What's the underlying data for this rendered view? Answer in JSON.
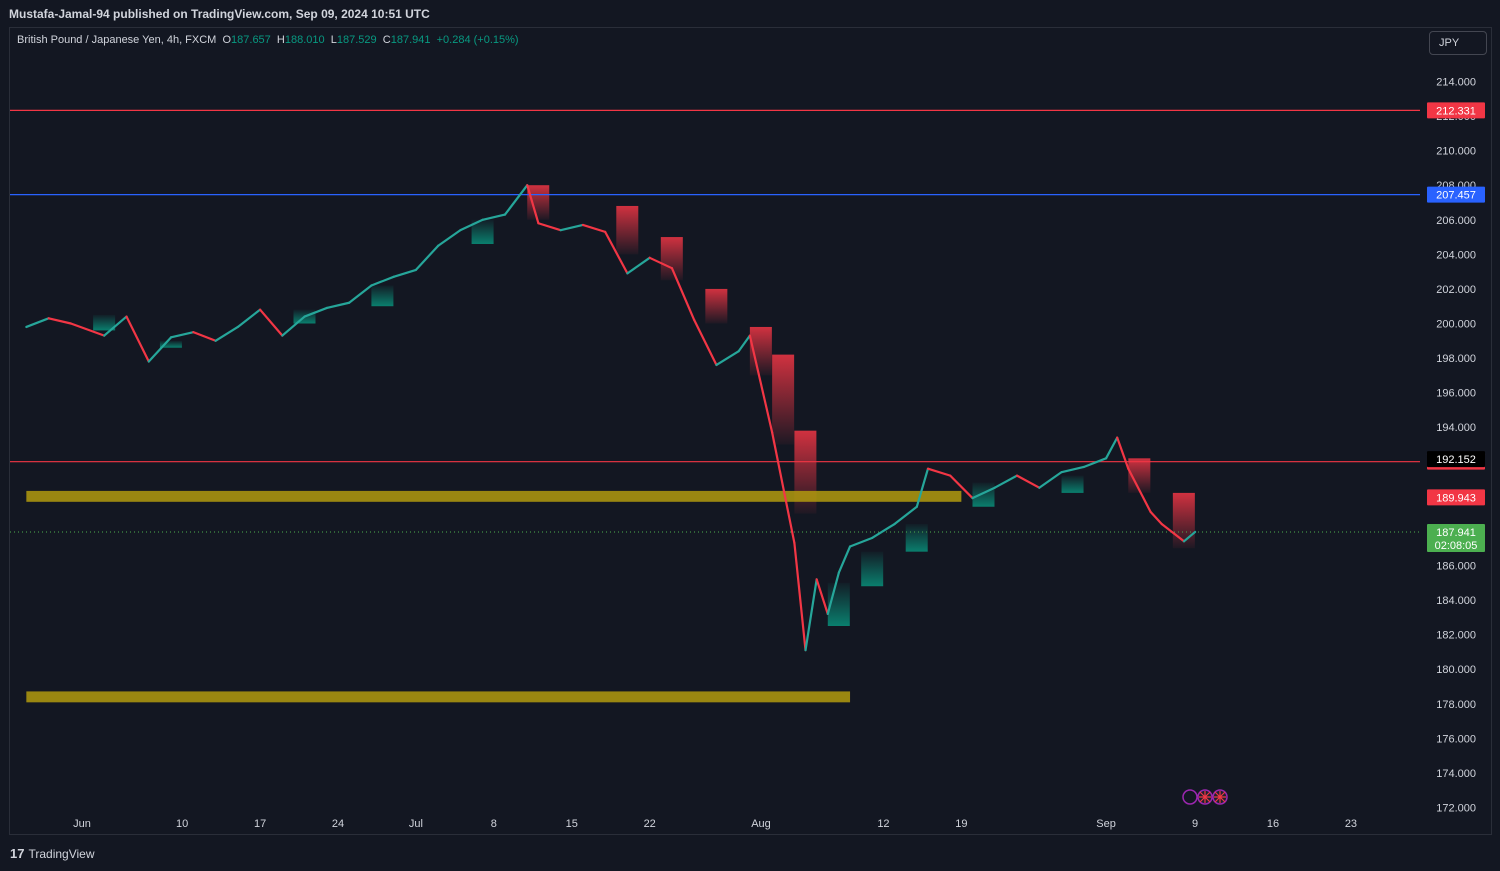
{
  "header": {
    "publisher": "Mustafa-Jamal-94 published on TradingView.com, Sep 09, 2024 10:51 UTC"
  },
  "legend": {
    "symbol": "British Pound / Japanese Yen, 4h, FXCM",
    "open_label": "O",
    "open": "187.657",
    "high_label": "H",
    "high": "188.010",
    "low_label": "L",
    "low": "187.529",
    "close_label": "C",
    "close": "187.941",
    "change": "+0.284 (+0.15%)"
  },
  "currency_button": "JPY",
  "footer": {
    "brand": "TradingView"
  },
  "colors": {
    "background": "#131722",
    "up": "#26a69a",
    "down": "#f23645",
    "red_line": "#f23645",
    "blue_line": "#2962ff",
    "zone": "#b39b0e",
    "last_price": "#4caf50"
  },
  "chart_data": {
    "type": "line",
    "title": "British Pound / Japanese Yen, 4h, FXCM",
    "xlabel": "",
    "ylabel": "",
    "ylim": [
      171.8,
      216.5
    ],
    "y_ticks": [
      172,
      174,
      176,
      178,
      180,
      182,
      184,
      186,
      188,
      190,
      192,
      194,
      196,
      198,
      200,
      202,
      204,
      206,
      208,
      210,
      212,
      214
    ],
    "y_tick_labels": [
      "172.000",
      "174.000",
      "176.000",
      "178.000",
      "180.000",
      "182.000",
      "184.000",
      "186.000",
      "188.000",
      "190.000",
      "192.000",
      "194.000",
      "196.000",
      "198.000",
      "200.000",
      "202.000",
      "204.000",
      "206.000",
      "208.000",
      "210.000",
      "212.000",
      "214.000"
    ],
    "x_ticks": [
      {
        "label": "Jun",
        "date": "2024-06-01"
      },
      {
        "label": "10",
        "date": "2024-06-10"
      },
      {
        "label": "17",
        "date": "2024-06-17"
      },
      {
        "label": "24",
        "date": "2024-06-24"
      },
      {
        "label": "Jul",
        "date": "2024-07-01"
      },
      {
        "label": "8",
        "date": "2024-07-08"
      },
      {
        "label": "15",
        "date": "2024-07-15"
      },
      {
        "label": "22",
        "date": "2024-07-22"
      },
      {
        "label": "Aug",
        "date": "2024-08-01"
      },
      {
        "label": "12",
        "date": "2024-08-12"
      },
      {
        "label": "19",
        "date": "2024-08-19"
      },
      {
        "label": "Sep",
        "date": "2024-09-01"
      },
      {
        "label": "9",
        "date": "2024-09-09"
      },
      {
        "label": "16",
        "date": "2024-09-16"
      },
      {
        "label": "23",
        "date": "2024-09-23"
      }
    ],
    "price_path": [
      [
        "2024-05-27",
        199.8
      ],
      [
        "2024-05-29",
        200.3
      ],
      [
        "2024-05-31",
        200.0
      ],
      [
        "2024-06-03",
        199.3
      ],
      [
        "2024-06-05",
        200.4
      ],
      [
        "2024-06-07",
        197.8
      ],
      [
        "2024-06-09",
        199.2
      ],
      [
        "2024-06-11",
        199.5
      ],
      [
        "2024-06-13",
        199.0
      ],
      [
        "2024-06-15",
        199.8
      ],
      [
        "2024-06-17",
        200.8
      ],
      [
        "2024-06-19",
        199.3
      ],
      [
        "2024-06-21",
        200.4
      ],
      [
        "2024-06-23",
        200.9
      ],
      [
        "2024-06-25",
        201.2
      ],
      [
        "2024-06-27",
        202.2
      ],
      [
        "2024-06-29",
        202.7
      ],
      [
        "2024-07-01",
        203.1
      ],
      [
        "2024-07-03",
        204.5
      ],
      [
        "2024-07-05",
        205.4
      ],
      [
        "2024-07-07",
        206.0
      ],
      [
        "2024-07-09",
        206.3
      ],
      [
        "2024-07-11",
        208.0
      ],
      [
        "2024-07-12",
        205.8
      ],
      [
        "2024-07-14",
        205.4
      ],
      [
        "2024-07-16",
        205.7
      ],
      [
        "2024-07-18",
        205.3
      ],
      [
        "2024-07-20",
        202.9
      ],
      [
        "2024-07-22",
        203.8
      ],
      [
        "2024-07-24",
        203.2
      ],
      [
        "2024-07-26",
        200.2
      ],
      [
        "2024-07-28",
        197.6
      ],
      [
        "2024-07-30",
        198.4
      ],
      [
        "2024-07-31",
        199.3
      ],
      [
        "2024-08-02",
        193.7
      ],
      [
        "2024-08-04",
        187.3
      ],
      [
        "2024-08-05",
        181.1
      ],
      [
        "2024-08-06",
        185.2
      ],
      [
        "2024-08-07",
        183.2
      ],
      [
        "2024-08-08",
        185.6
      ],
      [
        "2024-08-09",
        187.1
      ],
      [
        "2024-08-11",
        187.6
      ],
      [
        "2024-08-13",
        188.4
      ],
      [
        "2024-08-15",
        189.4
      ],
      [
        "2024-08-16",
        191.6
      ],
      [
        "2024-08-18",
        191.2
      ],
      [
        "2024-08-20",
        189.9
      ],
      [
        "2024-08-22",
        190.5
      ],
      [
        "2024-08-24",
        191.2
      ],
      [
        "2024-08-26",
        190.5
      ],
      [
        "2024-08-28",
        191.4
      ],
      [
        "2024-08-30",
        191.7
      ],
      [
        "2024-09-01",
        192.2
      ],
      [
        "2024-09-02",
        193.4
      ],
      [
        "2024-09-03",
        191.6
      ],
      [
        "2024-09-05",
        189.1
      ],
      [
        "2024-09-06",
        188.4
      ],
      [
        "2024-09-08",
        187.4
      ],
      [
        "2024-09-09",
        187.94
      ]
    ],
    "supply_zones": [
      {
        "date": "2024-07-11",
        "top": 208.0,
        "bottom": 206.0
      },
      {
        "date": "2024-07-19",
        "top": 206.8,
        "bottom": 204.0
      },
      {
        "date": "2024-07-23",
        "top": 205.0,
        "bottom": 202.5
      },
      {
        "date": "2024-07-27",
        "top": 202.0,
        "bottom": 200.0
      },
      {
        "date": "2024-07-31",
        "top": 199.8,
        "bottom": 197.0
      },
      {
        "date": "2024-08-02",
        "top": 198.2,
        "bottom": 193.0
      },
      {
        "date": "2024-08-04",
        "top": 193.8,
        "bottom": 189.0
      },
      {
        "date": "2024-09-03",
        "top": 192.2,
        "bottom": 190.2
      },
      {
        "date": "2024-09-07",
        "top": 190.2,
        "bottom": 187.0
      }
    ],
    "demand_zones": [
      {
        "date": "2024-06-02",
        "top": 200.5,
        "bottom": 199.6
      },
      {
        "date": "2024-06-08",
        "top": 199.0,
        "bottom": 198.6
      },
      {
        "date": "2024-06-20",
        "top": 200.8,
        "bottom": 200.0
      },
      {
        "date": "2024-06-27",
        "top": 202.2,
        "bottom": 201.0
      },
      {
        "date": "2024-07-06",
        "top": 206.0,
        "bottom": 204.6
      },
      {
        "date": "2024-08-07",
        "top": 185.0,
        "bottom": 182.5
      },
      {
        "date": "2024-08-10",
        "top": 186.8,
        "bottom": 184.8
      },
      {
        "date": "2024-08-14",
        "top": 188.4,
        "bottom": 186.8
      },
      {
        "date": "2024-08-20",
        "top": 190.8,
        "bottom": 189.4
      },
      {
        "date": "2024-08-28",
        "top": 191.2,
        "bottom": 190.2
      }
    ],
    "horizontal_levels": [
      {
        "name": "resistance",
        "value": 212.331,
        "label": "212.331",
        "color": "#f23645"
      },
      {
        "name": "blue-level",
        "value": 207.457,
        "label": "207.457",
        "color": "#2962ff"
      },
      {
        "name": "support",
        "value": 192.007,
        "label": "192.007",
        "color": "#f23645"
      }
    ],
    "zones": [
      {
        "name": "upper-zone",
        "top": 190.2,
        "bottom": 189.8,
        "start": "2024-05-27",
        "end": "2024-08-19"
      },
      {
        "name": "lower-zone",
        "top": 178.6,
        "bottom": 178.2,
        "start": "2024-05-27",
        "end": "2024-08-09"
      }
    ],
    "price_tags": [
      {
        "name": "crosshair-price",
        "value": 192.152,
        "label": "192.152",
        "color": "#000000"
      },
      {
        "name": "level-189943",
        "value": 189.943,
        "label": "189.943",
        "color": "#f23645"
      },
      {
        "name": "last-price",
        "value": 187.941,
        "label": "187.941",
        "countdown": "02:08:05",
        "color": "#4caf50"
      }
    ],
    "last_price": 187.941,
    "grid": false
  }
}
